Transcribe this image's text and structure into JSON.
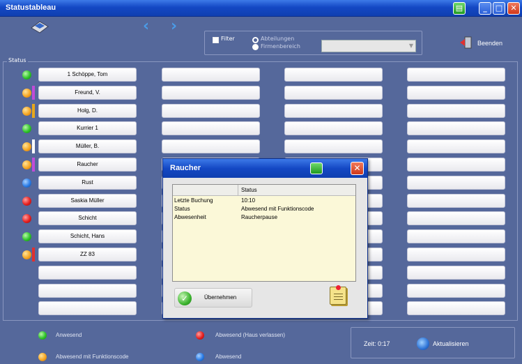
{
  "window": {
    "title": "Statustableau"
  },
  "toolbar": {
    "filter_label": "Filter",
    "radio_options": [
      "Abteilungen",
      "Firmenbereich"
    ],
    "selected_radio": "Abteilungen",
    "combo_value": "",
    "exit_label": "Beenden"
  },
  "status_group_label": "Status",
  "employees": [
    {
      "name": "1 Schöppe, Tom",
      "status": "green",
      "stripe": ""
    },
    {
      "name": "Freund, V.",
      "status": "orange",
      "stripe": "#c04cd8"
    },
    {
      "name": "Holg, D.",
      "status": "orange",
      "stripe": "#e8a81b"
    },
    {
      "name": "Kurrier 1",
      "status": "green",
      "stripe": ""
    },
    {
      "name": "Müller, B.",
      "status": "orange",
      "stripe": "#ffffff"
    },
    {
      "name": "Raucher",
      "status": "orange",
      "stripe": "#c04cd8"
    },
    {
      "name": "Rust",
      "status": "blue",
      "stripe": ""
    },
    {
      "name": "Saskia Müller",
      "status": "red",
      "stripe": ""
    },
    {
      "name": "Schicht",
      "status": "red",
      "stripe": ""
    },
    {
      "name": "Schicht, Hans",
      "status": "green",
      "stripe": ""
    },
    {
      "name": "ZZ 83",
      "status": "orange",
      "stripe": "#e03030"
    }
  ],
  "dialog": {
    "title": "Raucher",
    "column_header": "Status",
    "rows": [
      {
        "key": "Letzte Buchung",
        "value": "10:10"
      },
      {
        "key": "Status",
        "value": "Abwesend mit Funktionscode"
      },
      {
        "key": "Abwesenheit",
        "value": "Raucherpause"
      }
    ],
    "apply_label": "Übernehmen"
  },
  "legend": [
    {
      "label": "Anwesend",
      "color": "green"
    },
    {
      "label": "Abwesend (Haus verlassen)",
      "color": "red"
    },
    {
      "label": "Abwesend mit Funktionscode",
      "color": "orange"
    },
    {
      "label": "Abwesend",
      "color": "blue"
    }
  ],
  "footer": {
    "time_text": "Zeit: 0:17",
    "refresh_label": "Aktualisieren"
  },
  "colors": {
    "titlebar": "#1448c4",
    "background": "#55689b",
    "dialog_panel": "#fbf8d8"
  }
}
